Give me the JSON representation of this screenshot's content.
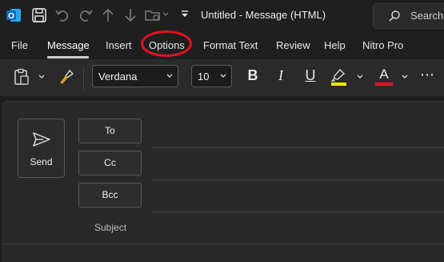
{
  "titlebar": {
    "app_icon": "outlook-icon",
    "title": "Untitled  -  Message (HTML)",
    "search_label": "Search"
  },
  "qat": [
    "save-icon",
    "undo-icon",
    "redo-icon",
    "arrow-up-icon",
    "arrow-down-icon",
    "folder-move-icon",
    "customize-qat-icon"
  ],
  "menu": {
    "tabs": [
      {
        "label": "File"
      },
      {
        "label": "Message",
        "active": true
      },
      {
        "label": "Insert"
      },
      {
        "label": "Options",
        "highlighted": true
      },
      {
        "label": "Format Text"
      },
      {
        "label": "Review"
      },
      {
        "label": "Help"
      },
      {
        "label": "Nitro Pro"
      }
    ],
    "highlight_color": "#e0141e"
  },
  "ribbon": {
    "font_name": "Verdana",
    "font_size": "10",
    "bold_glyph": "B",
    "italic_glyph": "I",
    "underline_glyph": "U",
    "highlight_color": "#f3e600",
    "font_color": "#e0141e",
    "font_color_glyph": "A",
    "more_glyph": "⋯"
  },
  "compose": {
    "send_label": "Send",
    "to_label": "To",
    "cc_label": "Cc",
    "bcc_label": "Bcc",
    "subject_label": "Subject"
  }
}
